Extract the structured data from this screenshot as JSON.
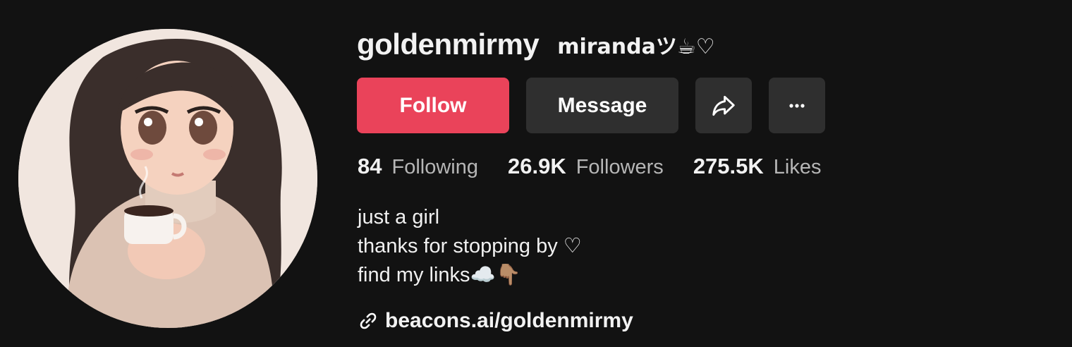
{
  "profile": {
    "username": "goldenmirmy",
    "nickname": "mirandaツ☕♡"
  },
  "actions": {
    "follow_label": "Follow",
    "message_label": "Message",
    "share_icon": "share-arrow-icon",
    "more_icon": "more-horizontal-icon"
  },
  "stats": [
    {
      "value": "84",
      "label": "Following"
    },
    {
      "value": "26.9K",
      "label": "Followers"
    },
    {
      "value": "275.5K",
      "label": "Likes"
    }
  ],
  "bio": {
    "lines": [
      "just a girl",
      "thanks for stopping by ♡",
      "find my links☁️👇🏽"
    ]
  },
  "link": {
    "icon": "link-icon",
    "text": "beacons.ai/goldenmirmy"
  },
  "colors": {
    "background": "#121212",
    "follow": "#ea435a",
    "secondary_button": "#2f2f2f",
    "muted_text": "#b6b6b6"
  }
}
